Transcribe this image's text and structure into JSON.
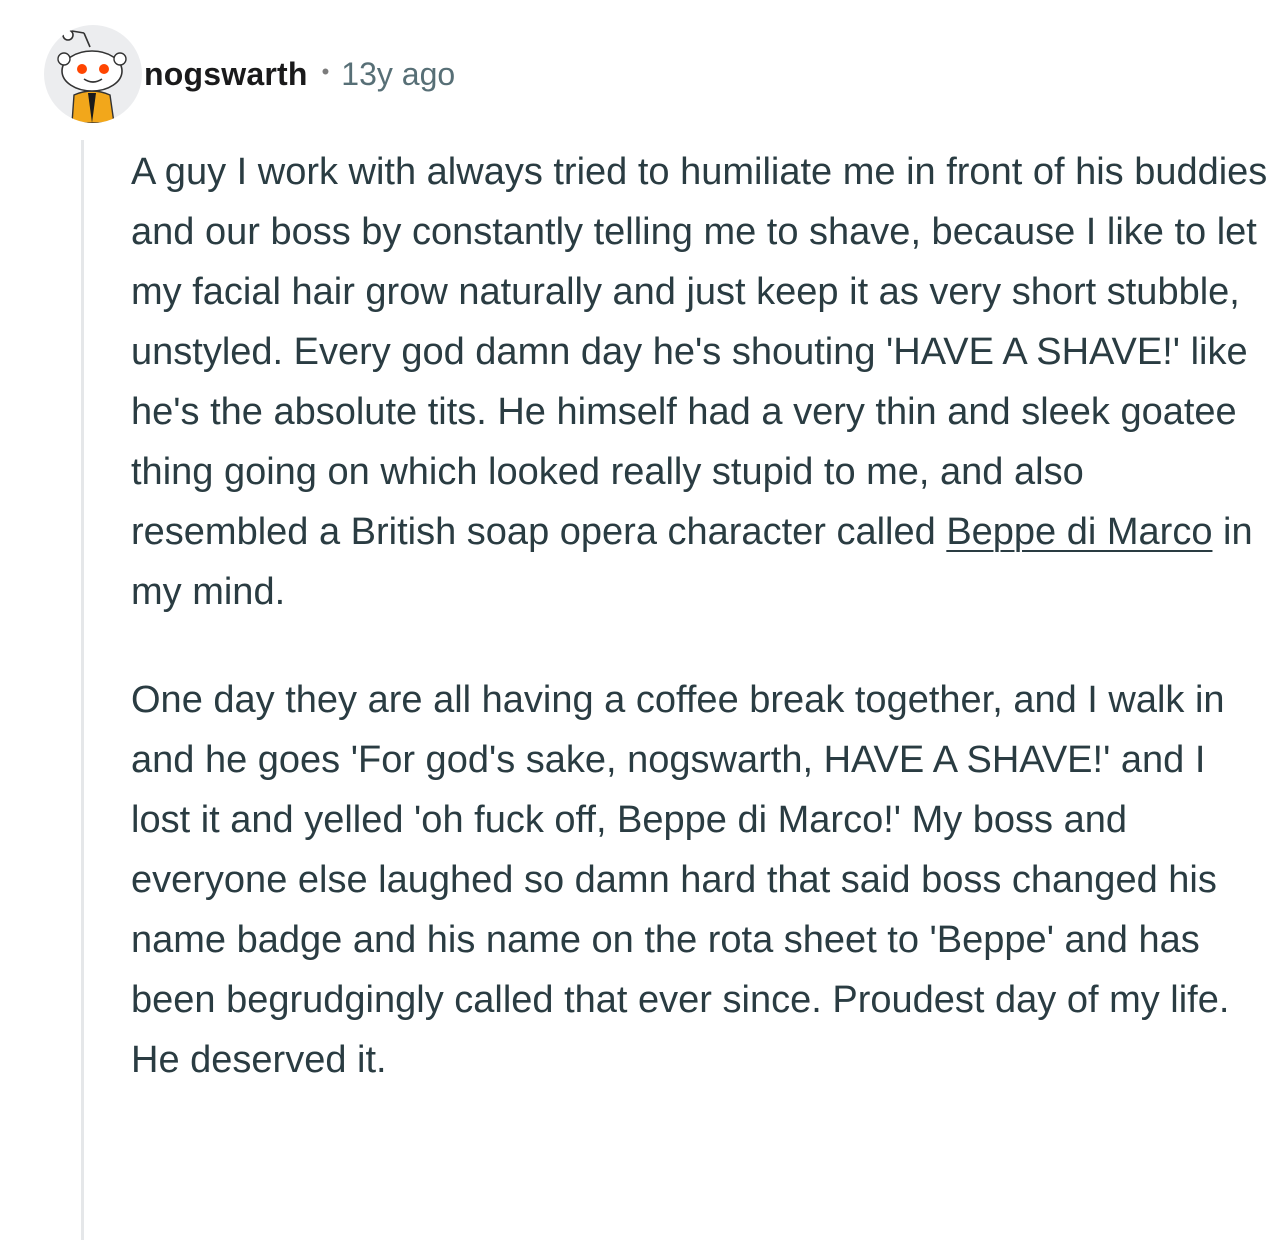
{
  "comment": {
    "author": "nogswarth",
    "separator": "•",
    "age": "13y ago",
    "avatar_icon": "reddit-snoo-avatar-icon",
    "paragraph1": {
      "text_before_link": "A guy I work with always tried to humiliate me in front of his buddies and our boss by constantly telling me to shave, because I like to let my facial hair grow naturally and just keep it as very short stubble, unstyled. Every god damn day he's shouting 'HAVE A SHAVE!' like he's the absolute tits. He himself had a very thin and sleek goatee thing going on which looked really stupid to me, and also resembled a British soap opera character called ",
      "link_text": "Beppe di Marco",
      "text_after_link": " in my mind."
    },
    "paragraph2": "One day they are all having a coffee break together, and I walk in and he goes 'For god's sake, nogswarth, HAVE A SHAVE!' and I lost it and yelled 'oh fuck off, Beppe di Marco!' My boss and everyone else laughed so damn hard that said boss changed his name badge and his name on the rota sheet to 'Beppe' and has been begrudgingly called that ever since. Proudest day of my life. He deserved it."
  },
  "colors": {
    "text": "#2a3c42",
    "meta": "#576f76",
    "thread_line": "#e5e7e9",
    "avatar_bg": "#ecedef",
    "snoo_eye": "#ff4500",
    "snoo_jacket": "#f2a71b"
  }
}
